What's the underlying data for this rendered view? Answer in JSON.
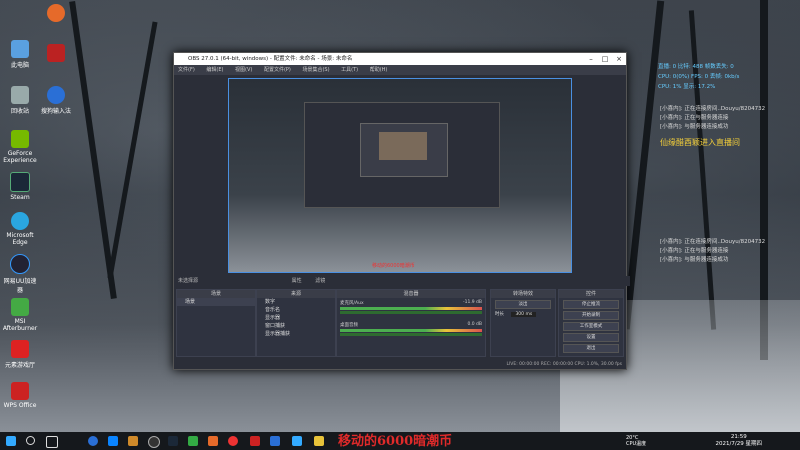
{
  "desktop": {
    "icons": [
      {
        "label": "此电脑"
      },
      {
        "label": "回收站"
      },
      {
        "label": "GeForce Experience"
      },
      {
        "label": "Steam"
      },
      {
        "label": "Microsoft Edge"
      },
      {
        "label": "网易UU加速器"
      },
      {
        "label": "MSI Afterburner"
      },
      {
        "label": "元素游戏厅"
      },
      {
        "label": "WPS Office"
      },
      {
        "label": "搜狗输入法"
      }
    ]
  },
  "obs": {
    "title": "OBS 27.0.1 (64-bit, windows) - 配置文件: 未命名 - 场景: 未命名",
    "menu": [
      "文件(F)",
      "编辑(E)",
      "视图(V)",
      "配置文件(P)",
      "场景集合(S)",
      "工具(T)",
      "帮助(H)"
    ],
    "preview_caption": "移动的6000暗潮币",
    "toolbar_label": "未选择源",
    "toolbar_props": "属性",
    "toolbar_filter": "滤镜",
    "docks": {
      "scenes": "场景",
      "sources": "来源",
      "mixer": "混音器",
      "transitions": "转场特效",
      "controls": "控件"
    },
    "scene_items": [
      "场景"
    ],
    "source_items": [
      "数字",
      "音乐名",
      "显示器",
      "窗口捕获",
      "显示器捕获"
    ],
    "mixer_tracks": [
      {
        "name": "麦克风/Aux",
        "db": "-11.9 dB"
      },
      {
        "name": "桌面音频",
        "db": "0.0 dB"
      }
    ],
    "transition": {
      "type": "淡出",
      "duration_label": "时长",
      "duration": "300 ms"
    },
    "controls": [
      "停止推流",
      "开始录制",
      "工作室模式",
      "设置",
      "退出"
    ],
    "status": "LIVE: 00:00:00   REC: 00:00:00   CPU: 1.0%, 30.00 fps"
  },
  "stats": {
    "lines": [
      "直播: 0    比特: 488    帧数丢失: 0",
      "CPU: 0(0%)    FPS: 0    丢帧: 0kb/s",
      "CPU: 1%    显示: 17.2%"
    ]
  },
  "chat_top": [
    {
      "user": "[小喜内]:",
      "text": "正在连接房间..Douyu/8204732"
    },
    {
      "user": "[小喜内]:",
      "text": "正在与服务器连接"
    },
    {
      "user": "[小喜内]:",
      "text": "与服务器连接成功"
    }
  ],
  "enter_msg": "仙缘醋酉颖进入直播间",
  "chat_bottom": [
    {
      "user": "[小喜内]:",
      "text": "正在连接房间..Douyu/8204732"
    },
    {
      "user": "[小喜内]:",
      "text": "正在与服务器连接"
    },
    {
      "user": "[小喜内]:",
      "text": "与服务器连接成功"
    }
  ],
  "taskbar": {
    "banner": "移动的6000暗潮币",
    "weather_temp": "20°C",
    "weather_label": "CPU温度",
    "time": "21:59",
    "date": "2021/7/29 星期四"
  }
}
